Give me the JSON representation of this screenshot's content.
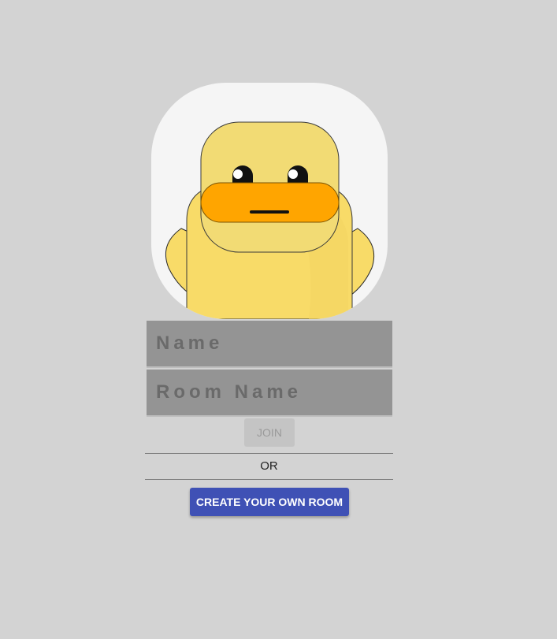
{
  "avatar": {
    "icon": "duck-icon",
    "colors": {
      "card": "#f5f5f5",
      "head": "#f2db74",
      "body": "#f8db68",
      "beak": "#ffa500"
    }
  },
  "form": {
    "name_placeholder": "Name",
    "room_placeholder": "Room Name",
    "join_label": "JOIN",
    "or_label": "OR",
    "create_label": "CREATE YOUR OWN ROOM"
  },
  "colors": {
    "background": "#d3d3d3",
    "input_background": "#949494",
    "primary": "#3f51b5",
    "disabled_button": "#c4c4c4"
  }
}
